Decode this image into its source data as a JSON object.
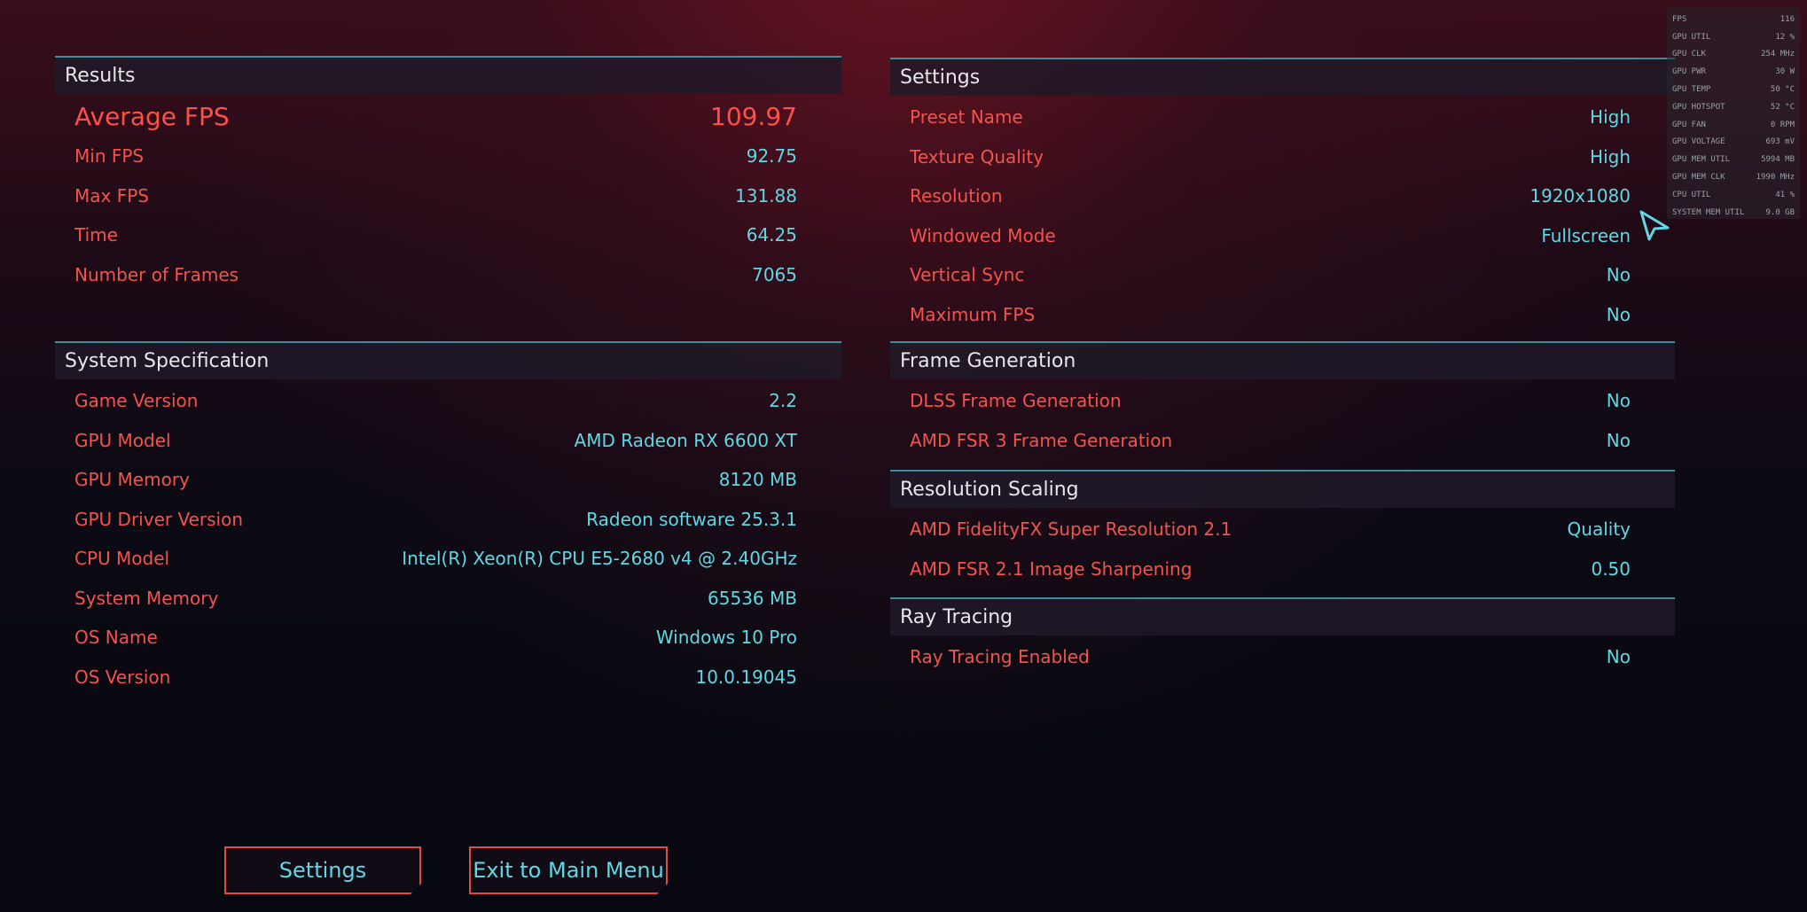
{
  "results": {
    "title": "Results",
    "average_fps": {
      "label": "Average FPS",
      "value": "109.97"
    },
    "rows": [
      {
        "label": "Min FPS",
        "value": "92.75"
      },
      {
        "label": "Max FPS",
        "value": "131.88"
      },
      {
        "label": "Time",
        "value": "64.25"
      },
      {
        "label": "Number of Frames",
        "value": "7065"
      }
    ]
  },
  "system_spec": {
    "title": "System Specification",
    "rows": [
      {
        "label": "Game Version",
        "value": "2.2"
      },
      {
        "label": "GPU Model",
        "value": "AMD Radeon RX 6600 XT"
      },
      {
        "label": "GPU Memory",
        "value": "8120 MB"
      },
      {
        "label": "GPU Driver Version",
        "value": "Radeon software 25.3.1"
      },
      {
        "label": "CPU Model",
        "value": "Intel(R) Xeon(R) CPU E5-2680 v4 @ 2.40GHz"
      },
      {
        "label": "System Memory",
        "value": "65536 MB"
      },
      {
        "label": "OS Name",
        "value": "Windows 10 Pro"
      },
      {
        "label": "OS Version",
        "value": "10.0.19045"
      }
    ]
  },
  "settings": {
    "title": "Settings",
    "rows": [
      {
        "label": "Preset Name",
        "value": "High"
      },
      {
        "label": "Texture Quality",
        "value": "High"
      },
      {
        "label": "Resolution",
        "value": "1920x1080"
      },
      {
        "label": "Windowed Mode",
        "value": "Fullscreen"
      },
      {
        "label": "Vertical Sync",
        "value": "No"
      },
      {
        "label": "Maximum FPS",
        "value": "No"
      }
    ]
  },
  "frame_generation": {
    "title": "Frame Generation",
    "rows": [
      {
        "label": "DLSS Frame Generation",
        "value": "No"
      },
      {
        "label": "AMD FSR 3 Frame Generation",
        "value": "No"
      }
    ]
  },
  "resolution_scaling": {
    "title": "Resolution Scaling",
    "rows": [
      {
        "label": "AMD FidelityFX Super Resolution 2.1",
        "value": "Quality"
      },
      {
        "label": "AMD FSR 2.1 Image Sharpening",
        "value": "0.50"
      }
    ]
  },
  "ray_tracing": {
    "title": "Ray Tracing",
    "rows": [
      {
        "label": "Ray Tracing Enabled",
        "value": "No"
      }
    ]
  },
  "buttons": {
    "settings": "Settings",
    "exit": "Exit to Main Menu"
  },
  "overlay": [
    {
      "label": "FPS",
      "value": "116"
    },
    {
      "label": "GPU UTIL",
      "value": "12 %"
    },
    {
      "label": "GPU CLK",
      "value": "254 MHz"
    },
    {
      "label": "GPU PWR",
      "value": "30 W"
    },
    {
      "label": "GPU TEMP",
      "value": "50 °C"
    },
    {
      "label": "GPU HOTSPOT",
      "value": "52 °C"
    },
    {
      "label": "GPU FAN",
      "value": "0 RPM"
    },
    {
      "label": "GPU VOLTAGE",
      "value": "693 mV"
    },
    {
      "label": "GPU MEM UTIL",
      "value": "5994 MB"
    },
    {
      "label": "GPU MEM CLK",
      "value": "1990 MHz"
    },
    {
      "label": "CPU UTIL",
      "value": "41 %"
    },
    {
      "label": "SYSTEM MEM UTIL",
      "value": "9.0 GB"
    }
  ],
  "colors": {
    "label": "#f2534e",
    "value": "#5fd8e3",
    "accent_line": "#3e8d99",
    "button_border": "#e24a47"
  },
  "icons": {
    "cursor": "cursor-arrow-icon"
  }
}
